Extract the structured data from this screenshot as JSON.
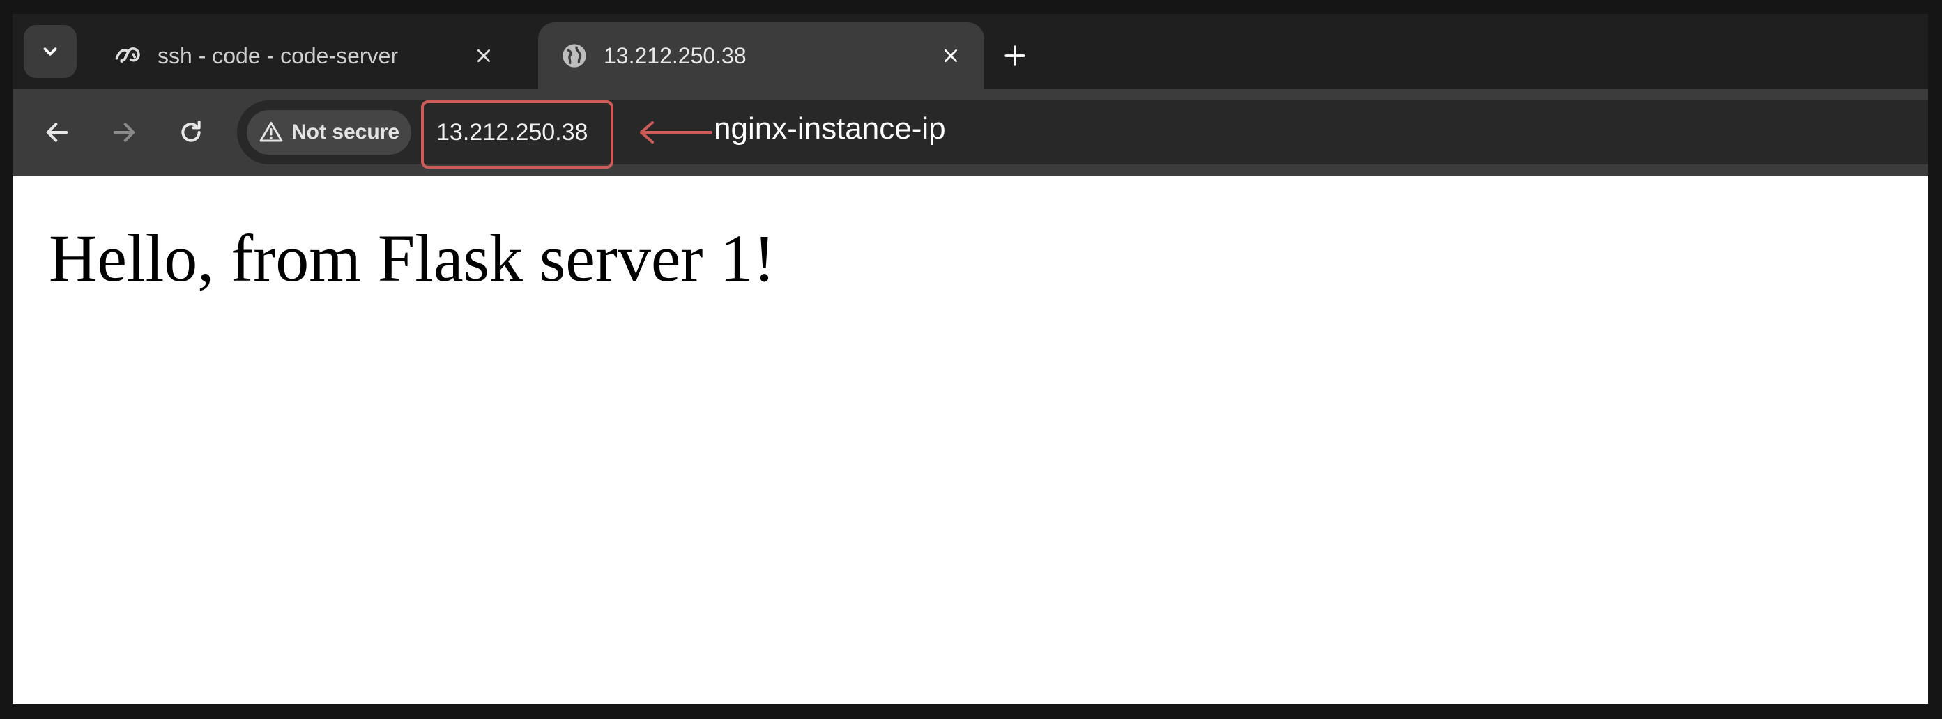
{
  "tabs": [
    {
      "title": "ssh - code - code-server",
      "active": false,
      "icon": "code-server-icon"
    },
    {
      "title": "13.212.250.38",
      "active": true,
      "icon": "globe-icon"
    }
  ],
  "toolbar": {
    "security_label": "Not secure",
    "url": "13.212.250.38"
  },
  "annotation": {
    "label": "nginx-instance-ip",
    "color": "#cd5b58"
  },
  "page": {
    "heading": "Hello, from Flask server 1!"
  },
  "colors": {
    "background": "#151515",
    "tab_strip": "#1f1f1f",
    "toolbar": "#3c3c3c",
    "omnibox": "#282828",
    "page": "#ffffff"
  }
}
